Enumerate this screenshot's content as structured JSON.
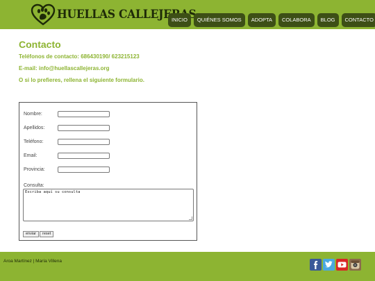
{
  "brand": {
    "name": "HUELLAS CALLEJERAS",
    "accent": "#8db432",
    "nav_bg": "#3d4f16"
  },
  "nav": {
    "items": [
      {
        "label": "INICIO"
      },
      {
        "label": "QUIÉNES SOMOS"
      },
      {
        "label": "ADOPTA"
      },
      {
        "label": "COLABORA"
      },
      {
        "label": "BLOG"
      },
      {
        "label": "CONTACTO"
      }
    ]
  },
  "contact": {
    "title": "Contacto",
    "phones": "Teléfonos de contacto: 686430190/ 623215123",
    "email": "E-mail: info@huellascallejeras.org",
    "prompt": "O si lo prefieres, rellena el siguiente formulario."
  },
  "form": {
    "nombre_label": "Nombre:",
    "apellidos_label": "Apellidos:",
    "telefono_label": "Teléfono:",
    "email_label": "Email:",
    "provincia_label": "Provincia:",
    "consulta_label": "Consulta:",
    "consulta_placeholder": "Escriba aquí su consulta",
    "submit_label": "enviar",
    "reset_label": "reset"
  },
  "footer": {
    "credits": "Aroa Martínez | María Villena",
    "social_icons": [
      "facebook-icon",
      "twitter-icon",
      "youtube-icon",
      "instagram-icon"
    ]
  }
}
